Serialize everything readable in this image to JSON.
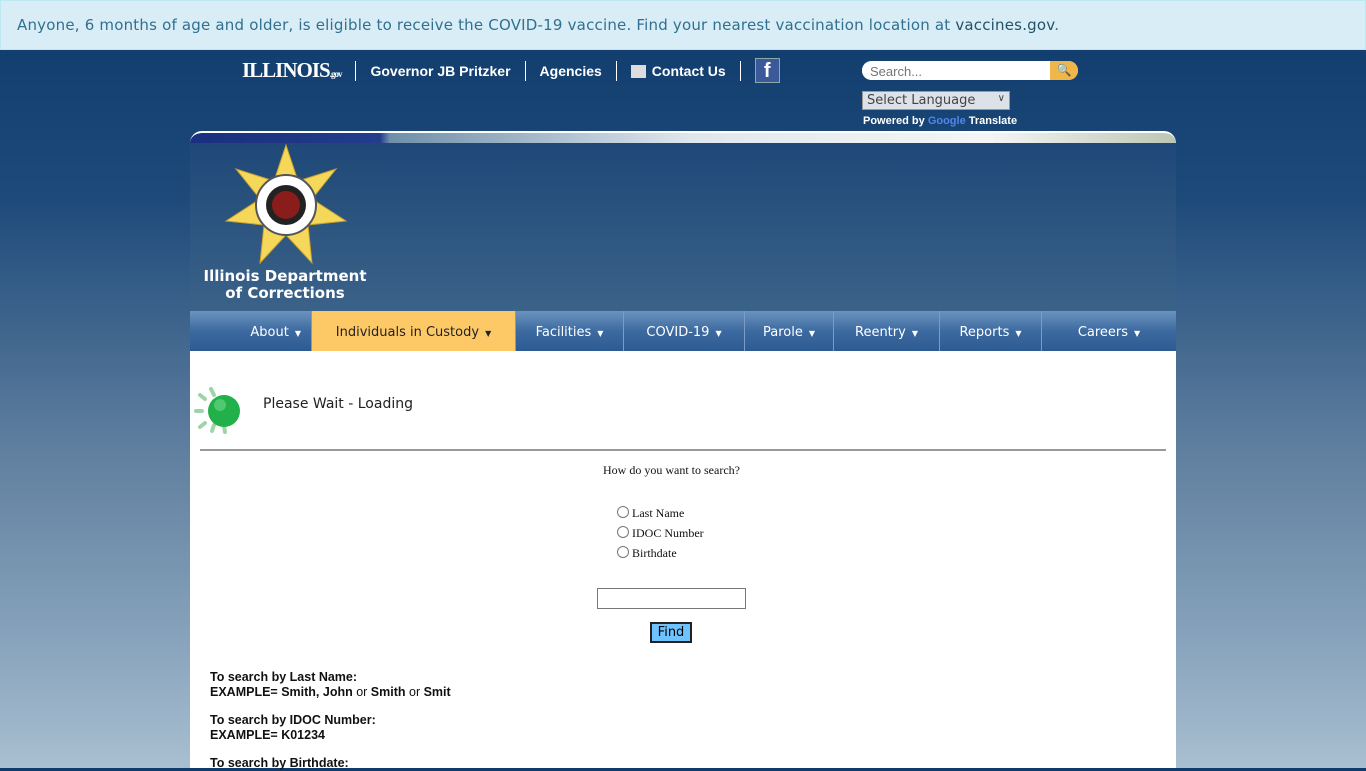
{
  "alert": {
    "text": "Anyone, 6 months of age and older, is eligible to receive the COVID-19 vaccine. Find your nearest vaccination location at ",
    "link": "vaccines.gov",
    "end": "."
  },
  "topnav": {
    "logo": "ILLINOIS",
    "logo_suffix": ".gov",
    "governor": "Governor JB Pritzker",
    "agencies": "Agencies",
    "contact": "Contact Us",
    "facebook": "f"
  },
  "search": {
    "placeholder": "Search..."
  },
  "translate": {
    "select": "Select Language",
    "powered": "Powered by",
    "google": "Google",
    "translate": "Translate"
  },
  "header": {
    "dept_line1": "Illinois Department",
    "dept_line2": "of Corrections"
  },
  "nav": {
    "items": [
      {
        "label": "About"
      },
      {
        "label": "Individuals in Custody"
      },
      {
        "label": "Facilities"
      },
      {
        "label": "COVID-19"
      },
      {
        "label": "Parole"
      },
      {
        "label": "Reentry"
      },
      {
        "label": "Reports"
      },
      {
        "label": "Careers"
      }
    ],
    "active": "Individuals in Custody",
    "active_color": "#fdc967"
  },
  "main": {
    "loading": "Please Wait - Loading",
    "question": "How do you want to search?",
    "options": [
      "Last Name",
      "IDOC Number",
      "Birthdate"
    ],
    "input_value": "",
    "find": "Find",
    "help": [
      {
        "title": "To search by Last Name:",
        "ex_label": "EXAMPLE= ",
        "ex_parts": [
          "Smith, John",
          " or ",
          "Smith",
          " or ",
          "Smit"
        ]
      },
      {
        "title": "To search by IDOC Number:",
        "ex_label": "EXAMPLE= ",
        "ex_parts": [
          "K01234"
        ]
      },
      {
        "title": "To search by Birthdate:"
      }
    ]
  }
}
